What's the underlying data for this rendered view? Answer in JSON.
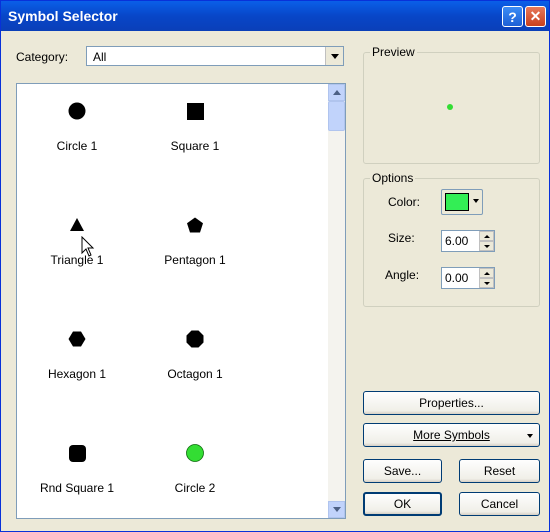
{
  "window": {
    "title": "Symbol Selector",
    "help_glyph": "?",
    "close_glyph": "✕"
  },
  "category": {
    "label": "Category:",
    "value": "All"
  },
  "symbols": [
    {
      "name": "Circle 1",
      "shape": "circle",
      "color": "#000000"
    },
    {
      "name": "Square 1",
      "shape": "square",
      "color": "#000000"
    },
    {
      "name": "Triangle 1",
      "shape": "triangle",
      "color": "#000000"
    },
    {
      "name": "Pentagon 1",
      "shape": "pentagon",
      "color": "#000000"
    },
    {
      "name": "Hexagon 1",
      "shape": "hexagon",
      "color": "#000000"
    },
    {
      "name": "Octagon 1",
      "shape": "octagon",
      "color": "#000000"
    },
    {
      "name": "Rnd Square 1",
      "shape": "rounded-square",
      "color": "#000000"
    },
    {
      "name": "Circle 2",
      "shape": "circle",
      "color": "#33dd33"
    }
  ],
  "preview": {
    "title": "Preview",
    "dot_color": "#33dd33"
  },
  "options": {
    "title": "Options",
    "color_label": "Color:",
    "color_value": "#33ee55",
    "size_label": "Size:",
    "size_value": "6.00",
    "angle_label": "Angle:",
    "angle_value": "0.00"
  },
  "buttons": {
    "properties": "Properties...",
    "more_symbols": "More Symbols",
    "save": "Save...",
    "reset": "Reset",
    "ok": "OK",
    "cancel": "Cancel"
  }
}
